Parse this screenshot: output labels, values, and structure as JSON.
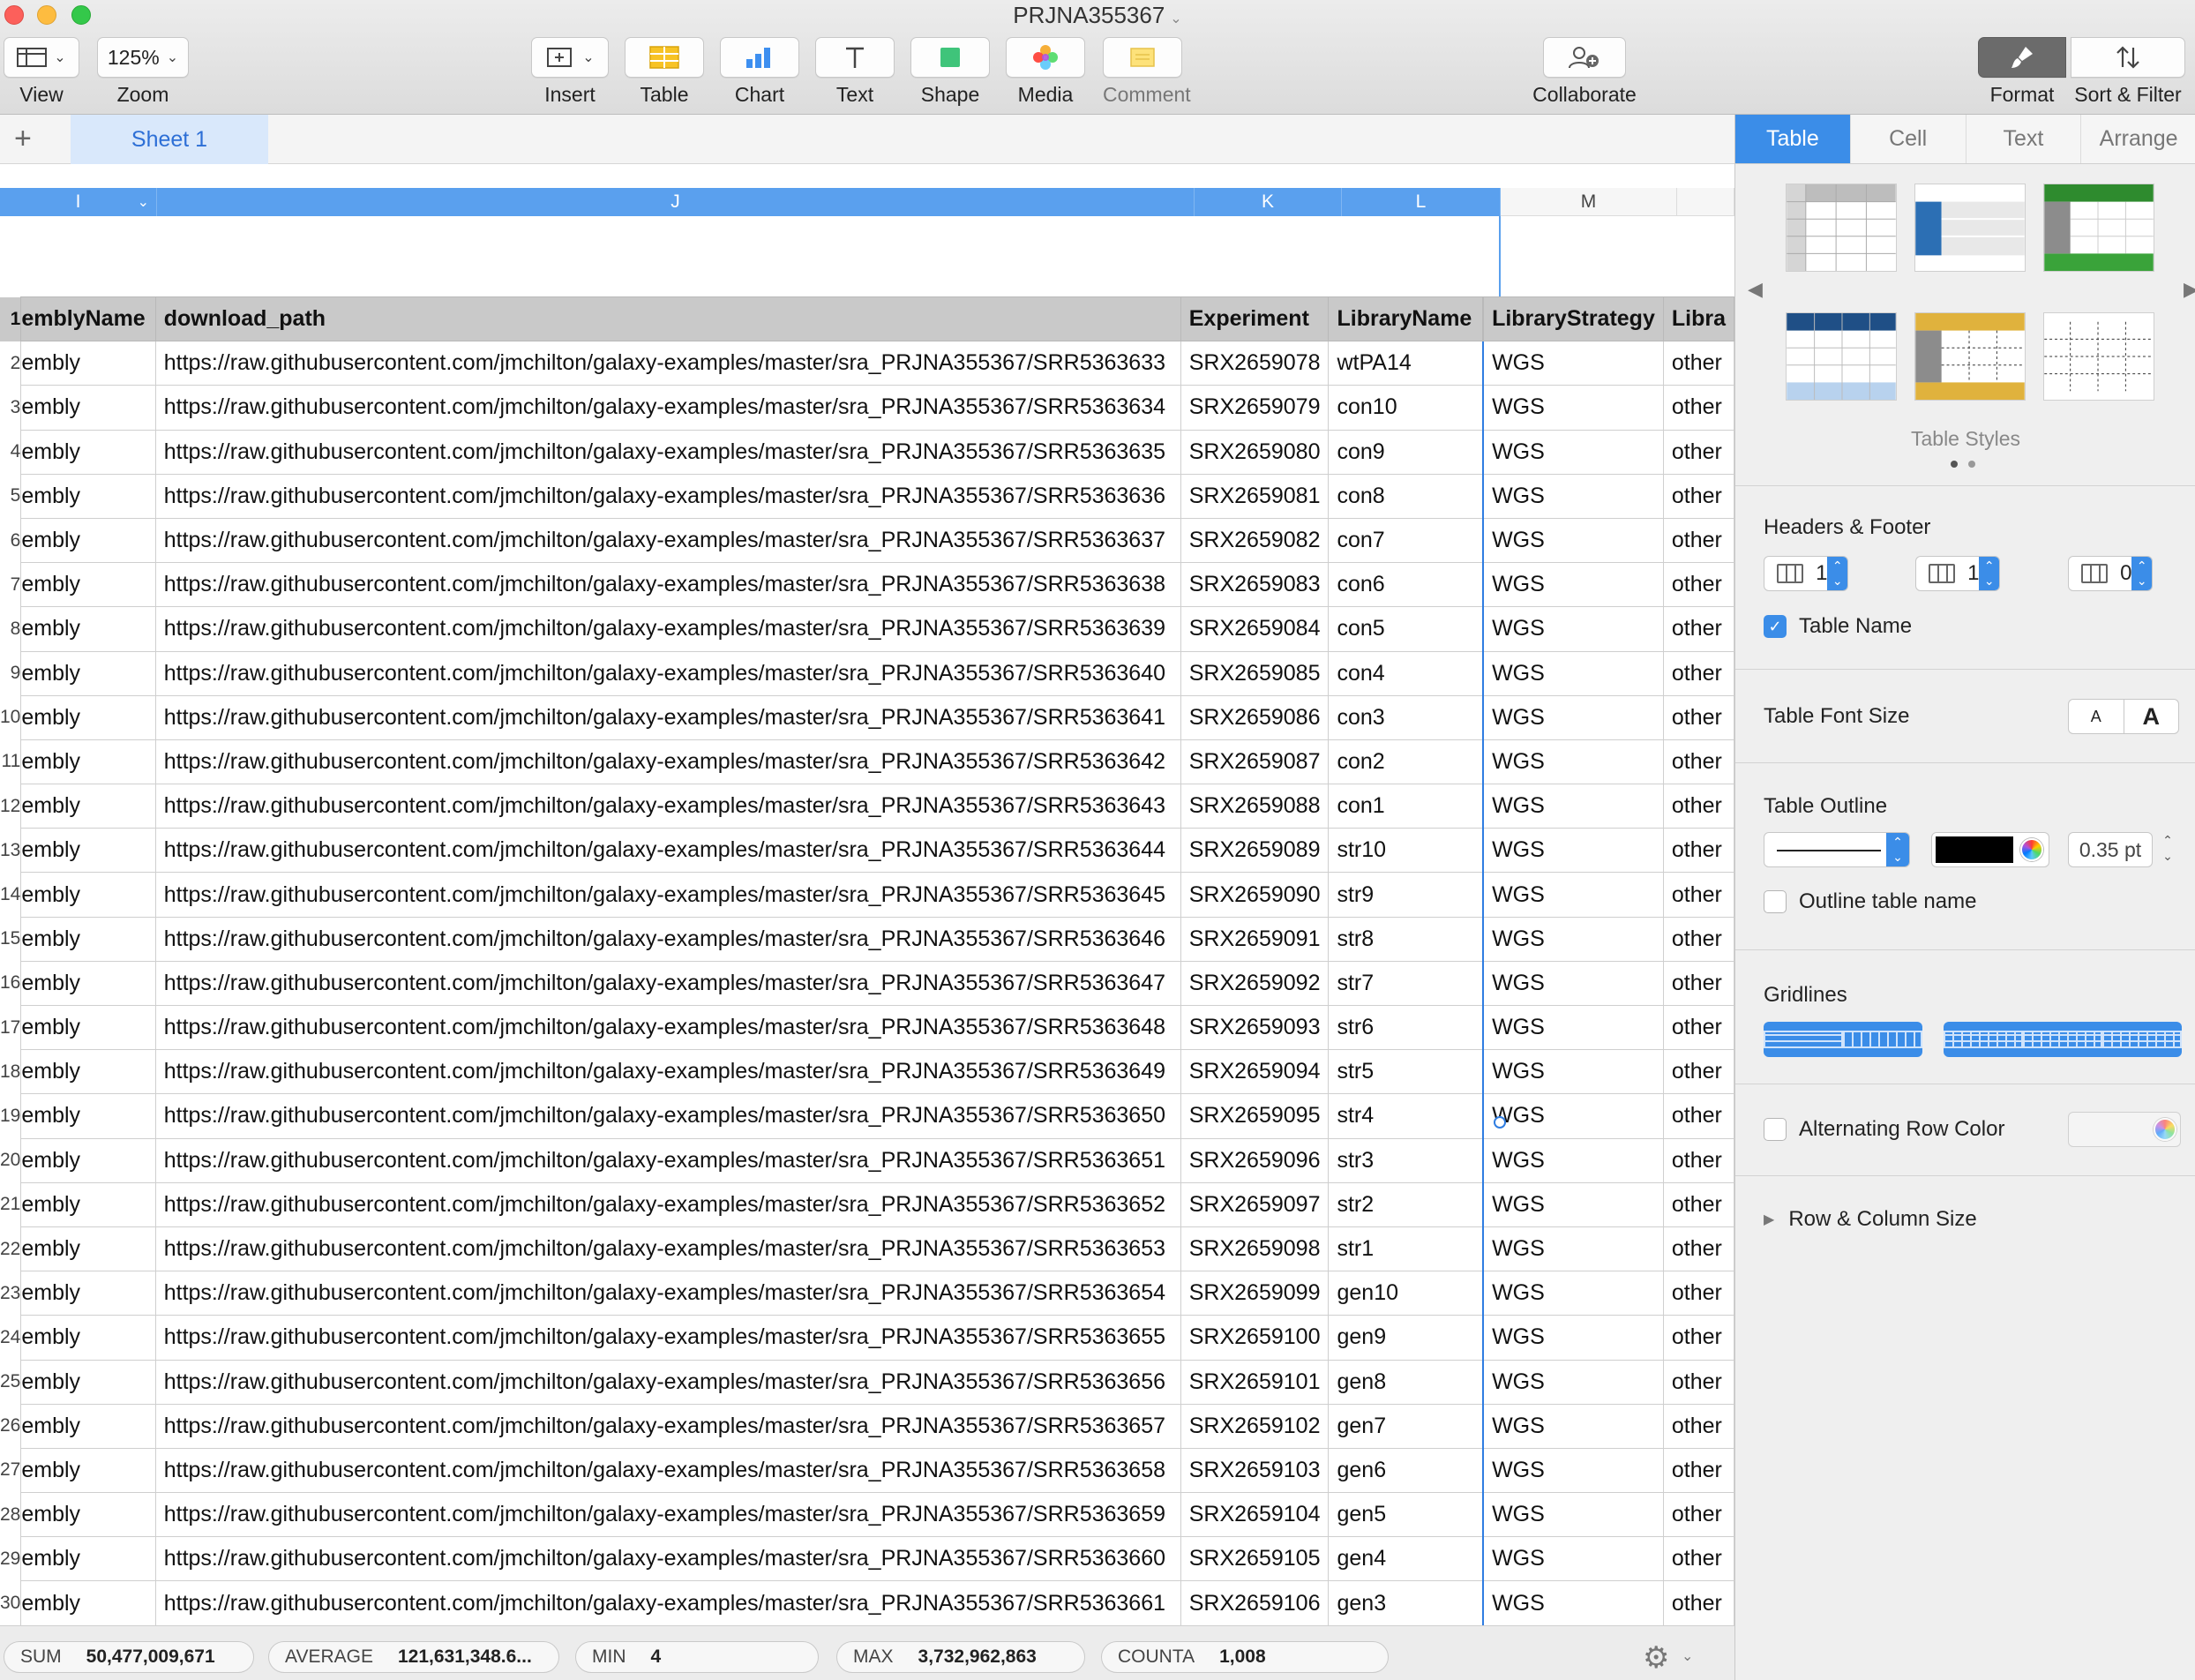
{
  "window": {
    "title": "PRJNA355367"
  },
  "toolbar": {
    "view_label": "View",
    "zoom_value": "125%",
    "zoom_label": "Zoom",
    "insert_label": "Insert",
    "table_label": "Table",
    "chart_label": "Chart",
    "text_label": "Text",
    "shape_label": "Shape",
    "media_label": "Media",
    "comment_label": "Comment",
    "collaborate_label": "Collaborate",
    "format_label": "Format",
    "sort_filter_label": "Sort & Filter"
  },
  "sheets": {
    "add_label": "+",
    "active": "Sheet 1"
  },
  "columns": [
    "I",
    "J",
    "K",
    "L",
    "M"
  ],
  "table": {
    "headers": [
      "emblyName",
      "download_path",
      "Experiment",
      "LibraryName",
      "LibraryStrategy",
      "Libra"
    ],
    "rows": [
      {
        "n": "2",
        "i": "embly",
        "path": "https://raw.githubusercontent.com/jmchilton/galaxy-examples/master/sra_PRJNA355367/SRR5363633",
        "exp": "SRX2659078",
        "lib": "wtPA14",
        "strat": "WGS",
        "src": "other"
      },
      {
        "n": "3",
        "i": "embly",
        "path": "https://raw.githubusercontent.com/jmchilton/galaxy-examples/master/sra_PRJNA355367/SRR5363634",
        "exp": "SRX2659079",
        "lib": "con10",
        "strat": "WGS",
        "src": "other"
      },
      {
        "n": "4",
        "i": "embly",
        "path": "https://raw.githubusercontent.com/jmchilton/galaxy-examples/master/sra_PRJNA355367/SRR5363635",
        "exp": "SRX2659080",
        "lib": "con9",
        "strat": "WGS",
        "src": "other"
      },
      {
        "n": "5",
        "i": "embly",
        "path": "https://raw.githubusercontent.com/jmchilton/galaxy-examples/master/sra_PRJNA355367/SRR5363636",
        "exp": "SRX2659081",
        "lib": "con8",
        "strat": "WGS",
        "src": "other"
      },
      {
        "n": "6",
        "i": "embly",
        "path": "https://raw.githubusercontent.com/jmchilton/galaxy-examples/master/sra_PRJNA355367/SRR5363637",
        "exp": "SRX2659082",
        "lib": "con7",
        "strat": "WGS",
        "src": "other"
      },
      {
        "n": "7",
        "i": "embly",
        "path": "https://raw.githubusercontent.com/jmchilton/galaxy-examples/master/sra_PRJNA355367/SRR5363638",
        "exp": "SRX2659083",
        "lib": "con6",
        "strat": "WGS",
        "src": "other"
      },
      {
        "n": "8",
        "i": "embly",
        "path": "https://raw.githubusercontent.com/jmchilton/galaxy-examples/master/sra_PRJNA355367/SRR5363639",
        "exp": "SRX2659084",
        "lib": "con5",
        "strat": "WGS",
        "src": "other"
      },
      {
        "n": "9",
        "i": "embly",
        "path": "https://raw.githubusercontent.com/jmchilton/galaxy-examples/master/sra_PRJNA355367/SRR5363640",
        "exp": "SRX2659085",
        "lib": "con4",
        "strat": "WGS",
        "src": "other"
      },
      {
        "n": "10",
        "i": "embly",
        "path": "https://raw.githubusercontent.com/jmchilton/galaxy-examples/master/sra_PRJNA355367/SRR5363641",
        "exp": "SRX2659086",
        "lib": "con3",
        "strat": "WGS",
        "src": "other"
      },
      {
        "n": "11",
        "i": "embly",
        "path": "https://raw.githubusercontent.com/jmchilton/galaxy-examples/master/sra_PRJNA355367/SRR5363642",
        "exp": "SRX2659087",
        "lib": "con2",
        "strat": "WGS",
        "src": "other"
      },
      {
        "n": "12",
        "i": "embly",
        "path": "https://raw.githubusercontent.com/jmchilton/galaxy-examples/master/sra_PRJNA355367/SRR5363643",
        "exp": "SRX2659088",
        "lib": "con1",
        "strat": "WGS",
        "src": "other"
      },
      {
        "n": "13",
        "i": "embly",
        "path": "https://raw.githubusercontent.com/jmchilton/galaxy-examples/master/sra_PRJNA355367/SRR5363644",
        "exp": "SRX2659089",
        "lib": "str10",
        "strat": "WGS",
        "src": "other"
      },
      {
        "n": "14",
        "i": "embly",
        "path": "https://raw.githubusercontent.com/jmchilton/galaxy-examples/master/sra_PRJNA355367/SRR5363645",
        "exp": "SRX2659090",
        "lib": "str9",
        "strat": "WGS",
        "src": "other"
      },
      {
        "n": "15",
        "i": "embly",
        "path": "https://raw.githubusercontent.com/jmchilton/galaxy-examples/master/sra_PRJNA355367/SRR5363646",
        "exp": "SRX2659091",
        "lib": "str8",
        "strat": "WGS",
        "src": "other"
      },
      {
        "n": "16",
        "i": "embly",
        "path": "https://raw.githubusercontent.com/jmchilton/galaxy-examples/master/sra_PRJNA355367/SRR5363647",
        "exp": "SRX2659092",
        "lib": "str7",
        "strat": "WGS",
        "src": "other"
      },
      {
        "n": "17",
        "i": "embly",
        "path": "https://raw.githubusercontent.com/jmchilton/galaxy-examples/master/sra_PRJNA355367/SRR5363648",
        "exp": "SRX2659093",
        "lib": "str6",
        "strat": "WGS",
        "src": "other"
      },
      {
        "n": "18",
        "i": "embly",
        "path": "https://raw.githubusercontent.com/jmchilton/galaxy-examples/master/sra_PRJNA355367/SRR5363649",
        "exp": "SRX2659094",
        "lib": "str5",
        "strat": "WGS",
        "src": "other"
      },
      {
        "n": "19",
        "i": "embly",
        "path": "https://raw.githubusercontent.com/jmchilton/galaxy-examples/master/sra_PRJNA355367/SRR5363650",
        "exp": "SRX2659095",
        "lib": "str4",
        "strat": "WGS",
        "src": "other"
      },
      {
        "n": "20",
        "i": "embly",
        "path": "https://raw.githubusercontent.com/jmchilton/galaxy-examples/master/sra_PRJNA355367/SRR5363651",
        "exp": "SRX2659096",
        "lib": "str3",
        "strat": "WGS",
        "src": "other"
      },
      {
        "n": "21",
        "i": "embly",
        "path": "https://raw.githubusercontent.com/jmchilton/galaxy-examples/master/sra_PRJNA355367/SRR5363652",
        "exp": "SRX2659097",
        "lib": "str2",
        "strat": "WGS",
        "src": "other"
      },
      {
        "n": "22",
        "i": "embly",
        "path": "https://raw.githubusercontent.com/jmchilton/galaxy-examples/master/sra_PRJNA355367/SRR5363653",
        "exp": "SRX2659098",
        "lib": "str1",
        "strat": "WGS",
        "src": "other"
      },
      {
        "n": "23",
        "i": "embly",
        "path": "https://raw.githubusercontent.com/jmchilton/galaxy-examples/master/sra_PRJNA355367/SRR5363654",
        "exp": "SRX2659099",
        "lib": "gen10",
        "strat": "WGS",
        "src": "other"
      },
      {
        "n": "24",
        "i": "embly",
        "path": "https://raw.githubusercontent.com/jmchilton/galaxy-examples/master/sra_PRJNA355367/SRR5363655",
        "exp": "SRX2659100",
        "lib": "gen9",
        "strat": "WGS",
        "src": "other"
      },
      {
        "n": "25",
        "i": "embly",
        "path": "https://raw.githubusercontent.com/jmchilton/galaxy-examples/master/sra_PRJNA355367/SRR5363656",
        "exp": "SRX2659101",
        "lib": "gen8",
        "strat": "WGS",
        "src": "other"
      },
      {
        "n": "26",
        "i": "embly",
        "path": "https://raw.githubusercontent.com/jmchilton/galaxy-examples/master/sra_PRJNA355367/SRR5363657",
        "exp": "SRX2659102",
        "lib": "gen7",
        "strat": "WGS",
        "src": "other"
      },
      {
        "n": "27",
        "i": "embly",
        "path": "https://raw.githubusercontent.com/jmchilton/galaxy-examples/master/sra_PRJNA355367/SRR5363658",
        "exp": "SRX2659103",
        "lib": "gen6",
        "strat": "WGS",
        "src": "other"
      },
      {
        "n": "28",
        "i": "embly",
        "path": "https://raw.githubusercontent.com/jmchilton/galaxy-examples/master/sra_PRJNA355367/SRR5363659",
        "exp": "SRX2659104",
        "lib": "gen5",
        "strat": "WGS",
        "src": "other"
      },
      {
        "n": "29",
        "i": "embly",
        "path": "https://raw.githubusercontent.com/jmchilton/galaxy-examples/master/sra_PRJNA355367/SRR5363660",
        "exp": "SRX2659105",
        "lib": "gen4",
        "strat": "WGS",
        "src": "other"
      },
      {
        "n": "30",
        "i": "embly",
        "path": "https://raw.githubusercontent.com/jmchilton/galaxy-examples/master/sra_PRJNA355367/SRR5363661",
        "exp": "SRX2659106",
        "lib": "gen3",
        "strat": "WGS",
        "src": "other"
      }
    ]
  },
  "status": {
    "sum_label": "SUM",
    "sum_value": "50,477,009,671",
    "avg_label": "AVERAGE",
    "avg_value": "121,631,348.6...",
    "min_label": "MIN",
    "min_value": "4",
    "max_label": "MAX",
    "max_value": "3,732,962,863",
    "counta_label": "COUNTA",
    "counta_value": "1,008"
  },
  "inspector": {
    "tabs": [
      "Table",
      "Cell",
      "Text",
      "Arrange"
    ],
    "active_tab": "Table",
    "table_styles_caption": "Table Styles",
    "headers_footer_title": "Headers & Footer",
    "header_rows": "1",
    "header_columns": "1",
    "footer_rows": "0",
    "table_name_label": "Table Name",
    "table_name_checked": true,
    "font_size_title": "Table Font Size",
    "font_smaller": "A",
    "font_larger": "A",
    "outline_title": "Table Outline",
    "outline_color": "#000000",
    "outline_width": "0.35 pt",
    "outline_name_label": "Outline table name",
    "gridlines_title": "Gridlines",
    "alt_row_label": "Alternating Row Color",
    "row_col_size_label": "Row & Column Size"
  },
  "colors": {
    "accent": "#3b8de8",
    "selection": "#5aa0ee",
    "header_row_bg": "#c9c9c9"
  }
}
